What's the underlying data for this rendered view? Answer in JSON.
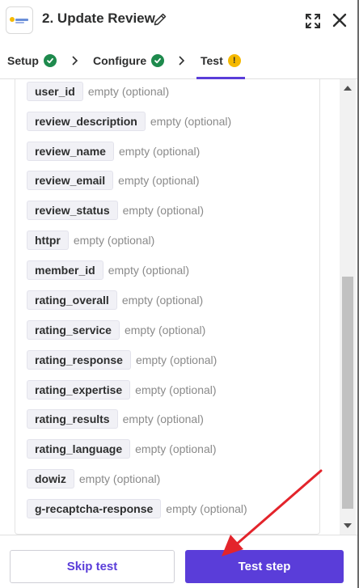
{
  "header": {
    "step_number": "2.",
    "title": "Update Review",
    "app_logo_icon": "app-logo-icon",
    "edit_icon": "pencil-icon",
    "expand_icon": "expand-icon",
    "close_icon": "close-icon"
  },
  "tabs": [
    {
      "label": "Setup",
      "status": "complete"
    },
    {
      "label": "Configure",
      "status": "complete"
    },
    {
      "label": "Test",
      "status": "warning",
      "active": true
    }
  ],
  "fields": [
    {
      "name": "user_id",
      "hint": "empty (optional)"
    },
    {
      "name": "review_description",
      "hint": "empty (optional)"
    },
    {
      "name": "review_name",
      "hint": "empty (optional)"
    },
    {
      "name": "review_email",
      "hint": "empty (optional)"
    },
    {
      "name": "review_status",
      "hint": "empty (optional)"
    },
    {
      "name": "httpr",
      "hint": "empty (optional)"
    },
    {
      "name": "member_id",
      "hint": "empty (optional)"
    },
    {
      "name": "rating_overall",
      "hint": "empty (optional)"
    },
    {
      "name": "rating_service",
      "hint": "empty (optional)"
    },
    {
      "name": "rating_response",
      "hint": "empty (optional)"
    },
    {
      "name": "rating_expertise",
      "hint": "empty (optional)"
    },
    {
      "name": "rating_results",
      "hint": "empty (optional)"
    },
    {
      "name": "rating_language",
      "hint": "empty (optional)"
    },
    {
      "name": "dowiz",
      "hint": "empty (optional)"
    },
    {
      "name": "g-recaptcha-response",
      "hint": "empty (optional)"
    }
  ],
  "footer": {
    "skip_label": "Skip test",
    "test_label": "Test step"
  },
  "colors": {
    "accent": "#5a3dd9",
    "success": "#1e8a4d",
    "warning": "#f5b900",
    "annotation": "#e3242b"
  }
}
